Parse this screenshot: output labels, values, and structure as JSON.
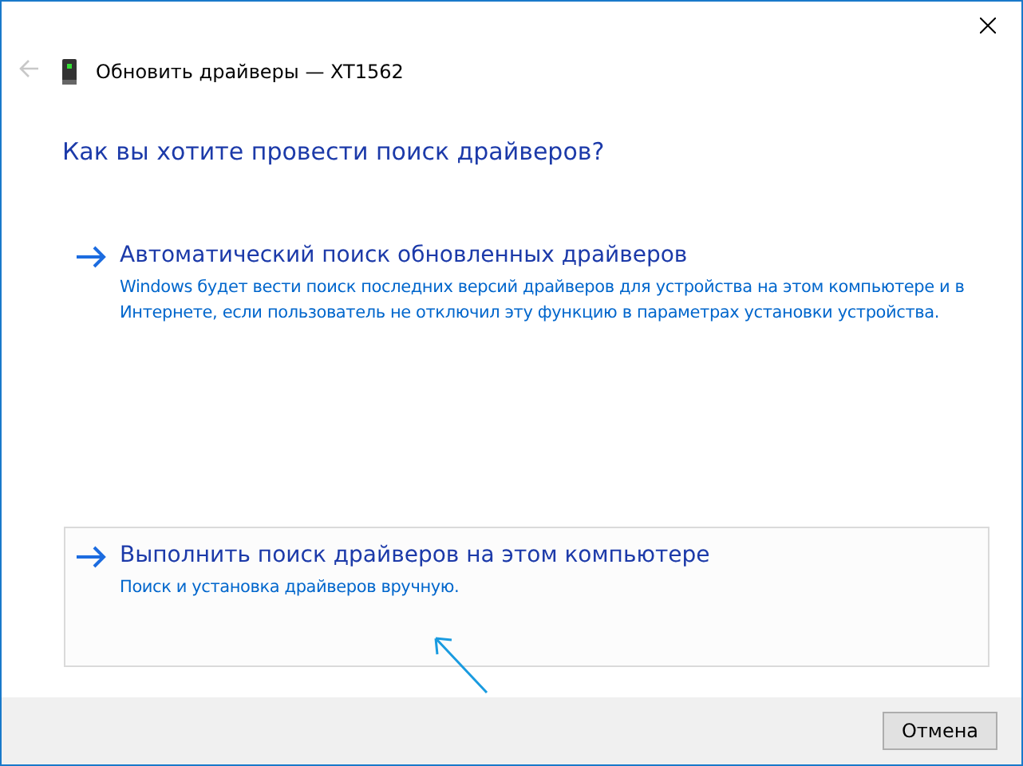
{
  "window": {
    "title": "Обновить драйверы — XT1562"
  },
  "heading": "Как вы хотите провести поиск драйверов?",
  "options": [
    {
      "title": "Автоматический поиск обновленных драйверов",
      "description": "Windows будет вести поиск последних версий драйверов для устройства на этом компьютере и в Интернете, если пользователь не отключил эту функцию в параметрах установки устройства.",
      "selected": false
    },
    {
      "title": "Выполнить поиск драйверов на этом компьютере",
      "description": "Поиск и установка драйверов вручную.",
      "selected": true
    }
  ],
  "buttons": [
    "Отмена"
  ]
}
